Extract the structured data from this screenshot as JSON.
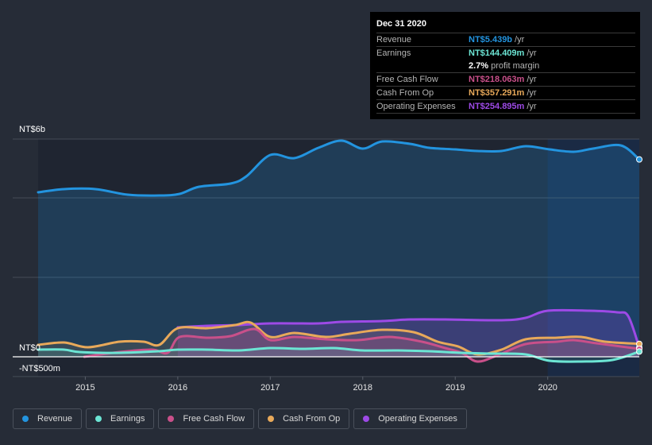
{
  "tooltip": {
    "title": "Dec 31 2020",
    "rows": [
      {
        "label": "Revenue",
        "value": "NT$5.439b",
        "unit": "/yr",
        "color": "#2394df"
      },
      {
        "label": "Earnings",
        "value": "NT$144.409m",
        "unit": "/yr",
        "color": "#6ce5d4"
      },
      {
        "label": "",
        "value": "2.7%",
        "unit": "profit margin",
        "color": "#ffffff"
      },
      {
        "label": "Free Cash Flow",
        "value": "NT$218.063m",
        "unit": "/yr",
        "color": "#c9508a"
      },
      {
        "label": "Cash From Op",
        "value": "NT$357.291m",
        "unit": "/yr",
        "color": "#e8a95a"
      },
      {
        "label": "Operating Expenses",
        "value": "NT$254.895m",
        "unit": "/yr",
        "color": "#9d4ae6"
      }
    ]
  },
  "legend": [
    {
      "label": "Revenue",
      "color": "#2394df"
    },
    {
      "label": "Earnings",
      "color": "#6ce5d4"
    },
    {
      "label": "Free Cash Flow",
      "color": "#c9508a"
    },
    {
      "label": "Cash From Op",
      "color": "#e8a95a"
    },
    {
      "label": "Operating Expenses",
      "color": "#9d4ae6"
    }
  ],
  "chart_data": {
    "type": "area",
    "title": "",
    "xlabel": "",
    "ylabel": "",
    "units": "NT$ millions",
    "ylim": [
      -500,
      6000
    ],
    "xlim": [
      2014.49,
      2020.99
    ],
    "y_tick_labels": [
      {
        "value": 6000,
        "label": "NT$6b"
      },
      {
        "value": 0,
        "label": "NT$0"
      },
      {
        "value": -500,
        "label": "-NT$500m"
      }
    ],
    "x_tick_labels": [
      {
        "value": 2015,
        "label": "2015"
      },
      {
        "value": 2016,
        "label": "2016"
      },
      {
        "value": 2017,
        "label": "2017"
      },
      {
        "value": 2018,
        "label": "2018"
      },
      {
        "value": 2019,
        "label": "2019"
      },
      {
        "value": 2020,
        "label": "2020"
      }
    ],
    "highlight_from": 2020.0,
    "grid": true,
    "legend_position": "bottom-left",
    "series": [
      {
        "name": "Revenue",
        "color": "#2394df",
        "points": [
          [
            2014.49,
            4533
          ],
          [
            2014.77,
            4621
          ],
          [
            2015.11,
            4621
          ],
          [
            2015.46,
            4467
          ],
          [
            2015.8,
            4445
          ],
          [
            2016.02,
            4489
          ],
          [
            2016.23,
            4686
          ],
          [
            2016.57,
            4774
          ],
          [
            2016.74,
            4971
          ],
          [
            2017.0,
            5562
          ],
          [
            2017.26,
            5474
          ],
          [
            2017.52,
            5759
          ],
          [
            2017.77,
            5956
          ],
          [
            2018.0,
            5737
          ],
          [
            2018.21,
            5934
          ],
          [
            2018.51,
            5869
          ],
          [
            2018.72,
            5759
          ],
          [
            2019.0,
            5715
          ],
          [
            2019.24,
            5672
          ],
          [
            2019.5,
            5672
          ],
          [
            2019.76,
            5803
          ],
          [
            2020.02,
            5715
          ],
          [
            2020.28,
            5650
          ],
          [
            2020.49,
            5737
          ],
          [
            2020.79,
            5825
          ],
          [
            2020.99,
            5439
          ]
        ]
      },
      {
        "name": "Earnings",
        "color": "#6ce5d4",
        "points": [
          [
            2014.49,
            197
          ],
          [
            2014.77,
            197
          ],
          [
            2014.94,
            131
          ],
          [
            2015.37,
            109
          ],
          [
            2015.8,
            153
          ],
          [
            2016.0,
            197
          ],
          [
            2016.32,
            197
          ],
          [
            2016.66,
            175
          ],
          [
            2017.0,
            241
          ],
          [
            2017.35,
            219
          ],
          [
            2017.69,
            241
          ],
          [
            2018.0,
            175
          ],
          [
            2018.38,
            175
          ],
          [
            2018.72,
            153
          ],
          [
            2019.07,
            109
          ],
          [
            2019.41,
            88
          ],
          [
            2019.76,
            66
          ],
          [
            2020.02,
            -110
          ],
          [
            2020.36,
            -131
          ],
          [
            2020.7,
            -88
          ],
          [
            2020.99,
            144
          ]
        ]
      },
      {
        "name": "Free Cash Flow",
        "color": "#c9508a",
        "points": [
          [
            2014.99,
            0
          ],
          [
            2015.37,
            131
          ],
          [
            2015.72,
            197
          ],
          [
            2015.89,
            109
          ],
          [
            2016.02,
            547
          ],
          [
            2016.32,
            526
          ],
          [
            2016.57,
            569
          ],
          [
            2016.83,
            766
          ],
          [
            2017.0,
            460
          ],
          [
            2017.26,
            547
          ],
          [
            2017.6,
            482
          ],
          [
            2017.95,
            460
          ],
          [
            2018.29,
            547
          ],
          [
            2018.64,
            416
          ],
          [
            2018.89,
            241
          ],
          [
            2019.07,
            109
          ],
          [
            2019.24,
            -131
          ],
          [
            2019.46,
            44
          ],
          [
            2019.76,
            350
          ],
          [
            2020.1,
            416
          ],
          [
            2020.28,
            460
          ],
          [
            2020.53,
            372
          ],
          [
            2020.99,
            218
          ]
        ]
      },
      {
        "name": "Cash From Op",
        "color": "#e8a95a",
        "points": [
          [
            2014.49,
            329
          ],
          [
            2014.77,
            394
          ],
          [
            2015.03,
            263
          ],
          [
            2015.37,
            416
          ],
          [
            2015.63,
            416
          ],
          [
            2015.8,
            329
          ],
          [
            2016.0,
            788
          ],
          [
            2016.32,
            788
          ],
          [
            2016.62,
            876
          ],
          [
            2016.79,
            941
          ],
          [
            2017.0,
            547
          ],
          [
            2017.26,
            657
          ],
          [
            2017.6,
            547
          ],
          [
            2017.86,
            635
          ],
          [
            2018.21,
            744
          ],
          [
            2018.55,
            679
          ],
          [
            2018.81,
            416
          ],
          [
            2019.03,
            285
          ],
          [
            2019.24,
            66
          ],
          [
            2019.5,
            197
          ],
          [
            2019.76,
            482
          ],
          [
            2020.1,
            526
          ],
          [
            2020.36,
            547
          ],
          [
            2020.62,
            416
          ],
          [
            2020.99,
            357
          ]
        ]
      },
      {
        "name": "Operating Expenses",
        "color": "#9d4ae6",
        "points": [
          [
            2016.0,
            810
          ],
          [
            2016.32,
            854
          ],
          [
            2016.66,
            876
          ],
          [
            2017.0,
            920
          ],
          [
            2017.52,
            920
          ],
          [
            2017.77,
            963
          ],
          [
            2018.21,
            985
          ],
          [
            2018.51,
            1029
          ],
          [
            2018.89,
            1029
          ],
          [
            2019.5,
            1007
          ],
          [
            2019.76,
            1073
          ],
          [
            2020.0,
            1270
          ],
          [
            2020.45,
            1270
          ],
          [
            2020.75,
            1226
          ],
          [
            2020.87,
            1120
          ],
          [
            2020.99,
            255
          ]
        ]
      }
    ]
  }
}
